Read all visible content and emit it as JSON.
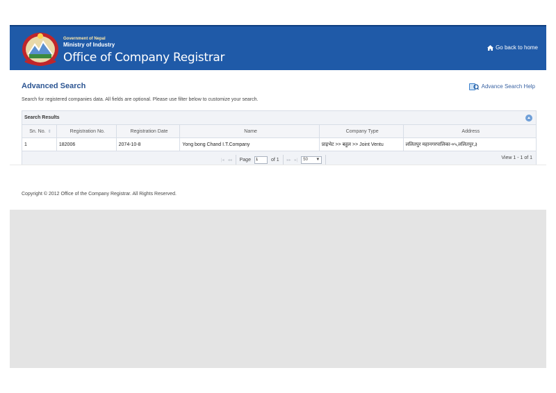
{
  "header": {
    "gov_label": "Government of Nepal",
    "ministry_label": "Ministry of Industry",
    "office_title": "Office of Company Registrar",
    "home_link": "Go back to home",
    "brand_color": "#1f5aa8"
  },
  "main": {
    "page_title": "Advanced Search",
    "help_link": "Advance Search Help",
    "description": "Search for registered companies data. All fields are optional. Please use filter below to customize your search."
  },
  "results": {
    "caption": "Search Results",
    "columns": [
      "Sn. No.",
      "Registration No.",
      "Registration Date",
      "Name",
      "Company Type",
      "Address"
    ],
    "rows": [
      [
        "1",
        "182006",
        "2074-10-8",
        "Yong bong Chand I.T.Company",
        "प्राइभेट >> बहुल >> Joint Ventu",
        "ललितपुर महानगरपालिका-०५,ललितपुर,३"
      ]
    ],
    "pager": {
      "page_label": "Page",
      "page_value": "1",
      "of_label": "of 1",
      "rows_per_page": "50",
      "view_info": "View 1 - 1 of 1"
    }
  },
  "footer": {
    "copyright": "Copyright © 2012 Office of the Company Registrar. All Rights Reserved."
  },
  "icons": {
    "emblem": "nepal-emblem-icon",
    "home": "home-icon",
    "help": "help-book-icon",
    "sort": "sort-icon",
    "collapse": "collapse-up-icon"
  }
}
